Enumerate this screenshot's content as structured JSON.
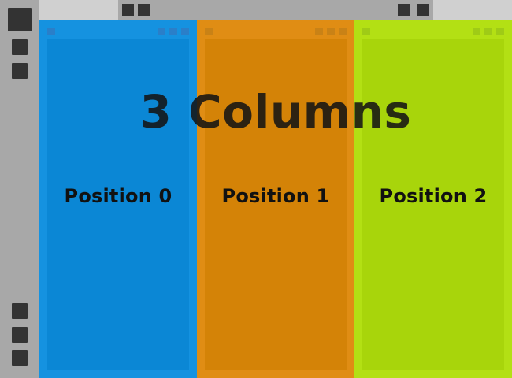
{
  "title": "3 Columns",
  "columns": [
    {
      "label": "Position 0",
      "color": "#1592e0"
    },
    {
      "label": "Position 1",
      "color": "#e08d14"
    },
    {
      "label": "Position 2",
      "color": "#b3e014"
    }
  ],
  "side_dock": {
    "buttons": [
      "window-square-icon",
      "window-square-icon",
      "window-square-icon",
      "window-square-icon",
      "window-square-icon",
      "window-square-icon"
    ]
  },
  "top_bar": {
    "buttons": [
      "window-square-icon",
      "window-square-icon",
      "window-square-icon",
      "window-square-icon"
    ]
  },
  "colors": {
    "dock": "#a8a8a8",
    "button": "#333333",
    "background": "#d0d0d0"
  }
}
